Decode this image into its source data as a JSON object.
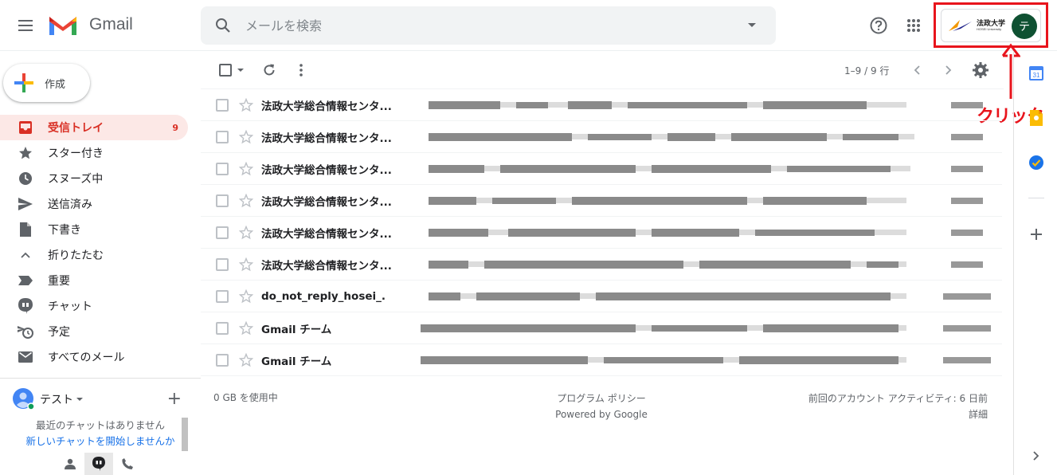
{
  "header": {
    "app_name": "Gmail",
    "search_placeholder": "メールを検索",
    "account_logo_jp": "法政大学",
    "account_logo_en": "HOSEI University",
    "avatar_initial": "テ"
  },
  "annotation": {
    "label": "クリック",
    "color": "#e8141c"
  },
  "sidebar": {
    "compose_label": "作成",
    "items": [
      {
        "label": "受信トレイ",
        "count": "9",
        "icon": "inbox-icon",
        "active": true
      },
      {
        "label": "スター付き",
        "count": "",
        "icon": "star-icon"
      },
      {
        "label": "スヌーズ中",
        "count": "",
        "icon": "clock-icon"
      },
      {
        "label": "送信済み",
        "count": "",
        "icon": "send-icon"
      },
      {
        "label": "下書き",
        "count": "",
        "icon": "draft-icon"
      },
      {
        "label": "折りたたむ",
        "count": "",
        "icon": "chevron-up-icon"
      },
      {
        "label": "重要",
        "count": "",
        "icon": "important-icon"
      },
      {
        "label": "チャット",
        "count": "",
        "icon": "chat-icon"
      },
      {
        "label": "予定",
        "count": "",
        "icon": "scheduled-icon"
      },
      {
        "label": "すべてのメール",
        "count": "",
        "icon": "all-mail-icon"
      }
    ],
    "hangouts": {
      "user_name": "テスト",
      "empty_text": "最近のチャットはありません",
      "start_link": "新しいチャットを開始しませんか"
    }
  },
  "toolbar": {
    "pagination": "1–9 / 9 行"
  },
  "mails": [
    {
      "sender": "法政大学総合情報センタ..."
    },
    {
      "sender": "法政大学総合情報センタ..."
    },
    {
      "sender": "法政大学総合情報センタ..."
    },
    {
      "sender": "法政大学総合情報センタ..."
    },
    {
      "sender": "法政大学総合情報センタ..."
    },
    {
      "sender": "法政大学総合情報センタ..."
    },
    {
      "sender": "do_not_reply_hosei_."
    },
    {
      "sender": "Gmail チーム"
    },
    {
      "sender": "Gmail チーム"
    }
  ],
  "footer": {
    "storage": "0 GB を使用中",
    "policy": "プログラム ポリシー",
    "powered": "Powered by Google",
    "last_activity": "前回のアカウント アクティビティ: 6 日前",
    "details": "詳細"
  },
  "colors": {
    "accent_red": "#d93025",
    "inbox_active_bg": "#fce8e6",
    "avatar_bg": "#0f5132"
  }
}
